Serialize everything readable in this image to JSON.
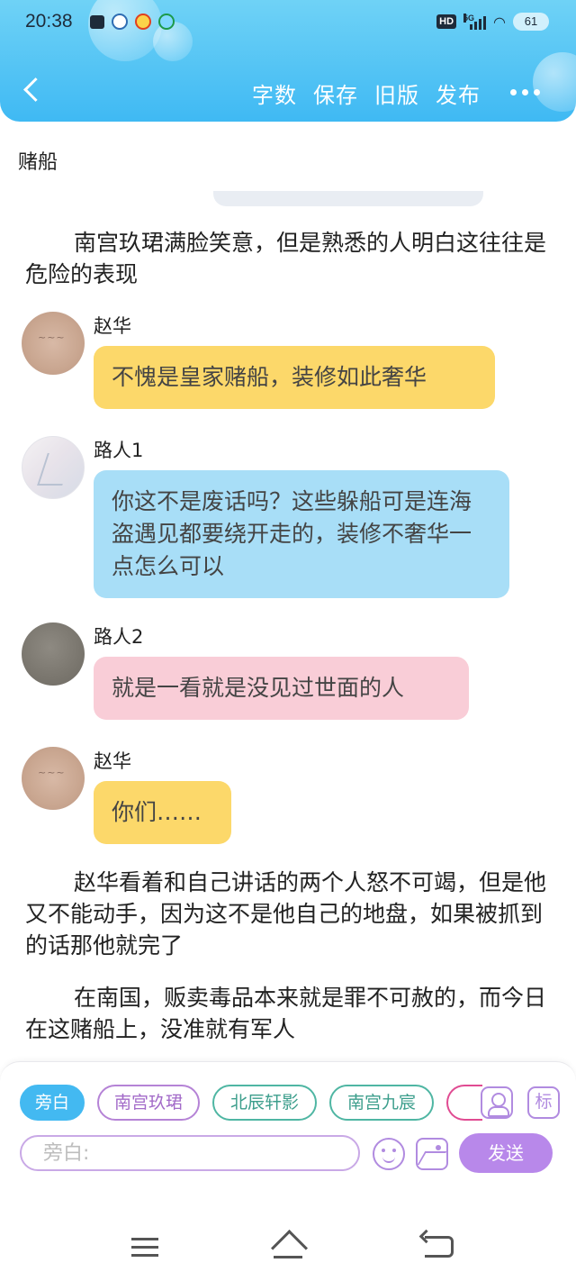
{
  "status_bar": {
    "time": "20:38",
    "network": "5G",
    "hd_badge": "HD",
    "battery": "61"
  },
  "header": {
    "back_icon": "chevron-left-icon",
    "toolbar": [
      "字数",
      "保存",
      "旧版",
      "发布"
    ],
    "more_icon": "more-dots-icon",
    "color": "#3fb9f3"
  },
  "document": {
    "title": "赌船"
  },
  "content": {
    "narration_1": "南宫玖珺满脸笑意，但是熟悉的人明白这往往是危险的表现",
    "messages": [
      {
        "name": "赵华",
        "text": "不愧是皇家赌船，装修如此奢华",
        "color": "#fcd86a"
      },
      {
        "name": "路人1",
        "text": "你这不是废话吗？这些躲船可是连海盗遇见都要绕开走的，装修不奢华一点怎么可以",
        "color": "#a8def7"
      },
      {
        "name": "路人2",
        "text": "就是一看就是没见过世面的人",
        "color": "#f9cdd7"
      },
      {
        "name": "赵华",
        "text": "你们……",
        "color": "#fcd86a"
      }
    ],
    "narration_2": "赵华看着和自己讲话的两个人怒不可竭，但是他又不能动手，因为这不是他自己的地盘，如果被抓到的话那他就完了",
    "narration_3": "在南国，贩卖毒品本来就是罪不可赦的，而今日在这赌船上，没准就有军人"
  },
  "composer": {
    "role_chips": [
      "旁白",
      "南宫玖珺",
      "北辰轩影",
      "南宫九宸"
    ],
    "selected_role": "旁白",
    "role_button_icon": "person-card-icon",
    "tag_button": "标",
    "input_placeholder": "旁白:",
    "emoji_icon": "emoji-icon",
    "image_icon": "image-icon",
    "send_label": "发送",
    "accent": "#b888ea"
  },
  "navbar": {
    "icons": [
      "menu-icon",
      "home-icon",
      "back-icon"
    ]
  }
}
